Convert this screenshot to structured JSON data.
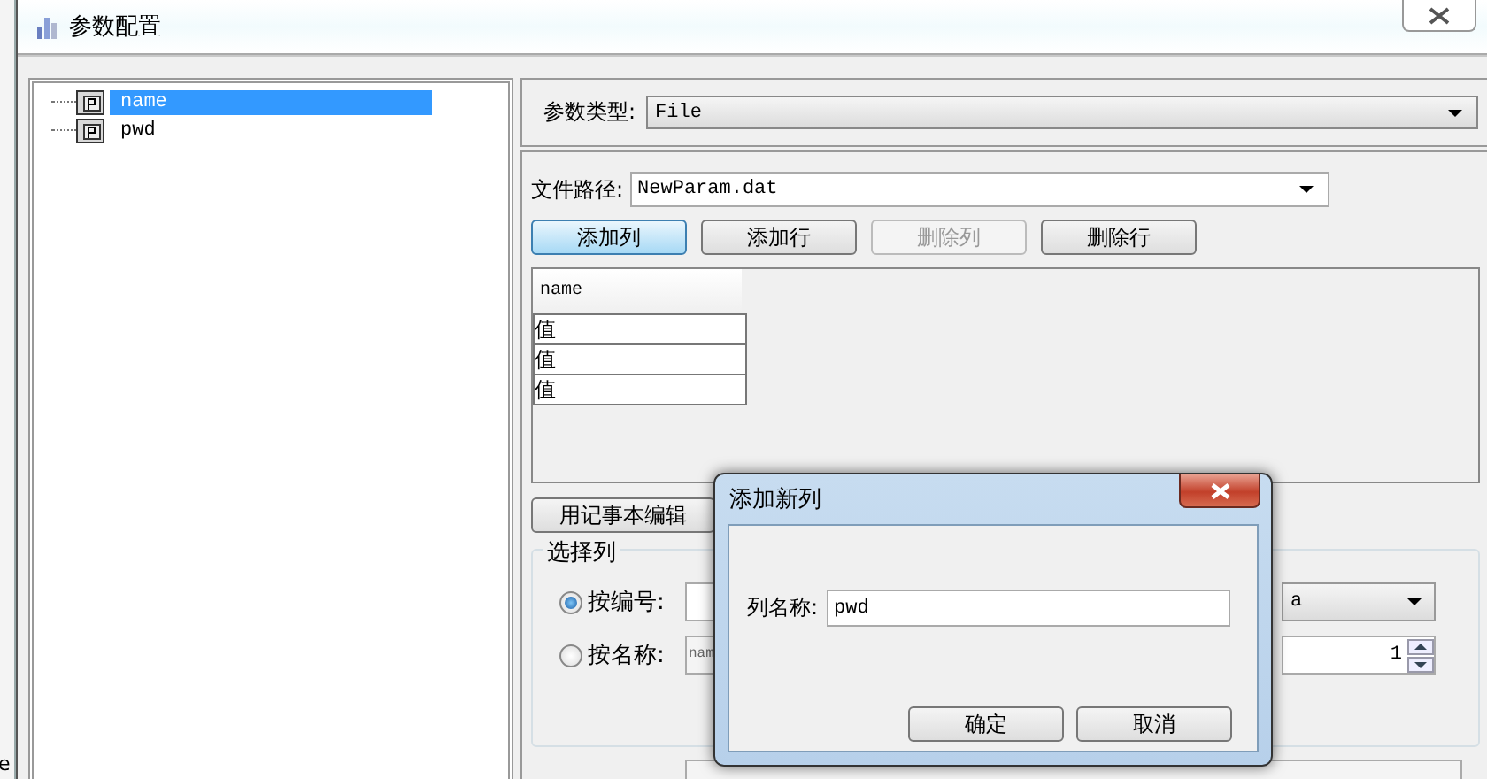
{
  "background_window": {
    "text": "e"
  },
  "window": {
    "title": "参数配置"
  },
  "tree": {
    "items": [
      {
        "label": "name",
        "selected": true
      },
      {
        "label": "pwd",
        "selected": false
      }
    ]
  },
  "param_type": {
    "label": "参数类型:",
    "value": "File"
  },
  "file_path": {
    "label": "文件路径:",
    "value": "NewParam.dat"
  },
  "buttons": [
    {
      "label": "添加列",
      "focused": true,
      "disabled": false
    },
    {
      "label": "添加行",
      "focused": false,
      "disabled": false
    },
    {
      "label": "删除列",
      "focused": false,
      "disabled": true
    },
    {
      "label": "删除行",
      "focused": false,
      "disabled": false
    }
  ],
  "table": {
    "columns": [
      "name"
    ],
    "rows": [
      [
        "值"
      ],
      [
        "值"
      ],
      [
        "值"
      ]
    ]
  },
  "notepad_button": {
    "label": "用记事本编辑"
  },
  "select_column": {
    "title": "选择列",
    "options": [
      {
        "label": "按编号:",
        "selected": true,
        "kind": "dropdown",
        "value": "a"
      },
      {
        "label": "按名称:",
        "selected": false,
        "kind": "spinner",
        "field_value": "nam",
        "value": "1"
      }
    ]
  },
  "dialog": {
    "title": "添加新列",
    "label": "列名称:",
    "value": "pwd",
    "buttons": [
      "确定",
      "取消"
    ]
  }
}
